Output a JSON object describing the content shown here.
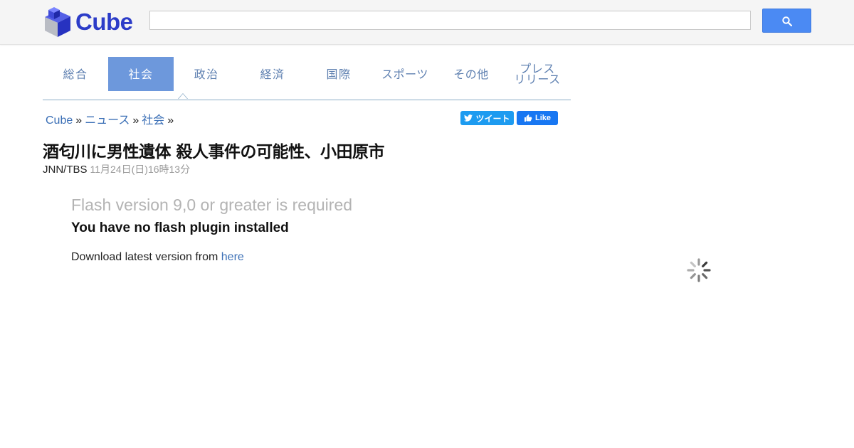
{
  "header": {
    "logo_text": "Cube",
    "search_placeholder": "",
    "search_icon": "search-icon"
  },
  "nav": {
    "tabs": [
      {
        "label": "総合"
      },
      {
        "label": "社会"
      },
      {
        "label": "政治"
      },
      {
        "label": "経済"
      },
      {
        "label": "国際"
      },
      {
        "label": "スポーツ"
      },
      {
        "label": "その他"
      },
      {
        "label_line1": "プレス",
        "label_line2": "リリース"
      }
    ],
    "active_index": 1
  },
  "breadcrumb": {
    "items": [
      "Cube",
      "ニュース",
      "社会"
    ],
    "separator": "»"
  },
  "share": {
    "tweet_label": "ツイート",
    "like_label": "Like"
  },
  "article": {
    "title": "酒匂川に男性遺体 殺人事件の可能性、小田原市",
    "source": "JNN/TBS",
    "date": "11月24日(日)16時13分"
  },
  "flash": {
    "title": "Flash version 9,0 or greater is required",
    "subtitle": "You have no flash plugin installed",
    "download_prefix": "Download latest version from ",
    "download_link": "here"
  },
  "colors": {
    "accent": "#6d98dc",
    "link": "#3b6fb6",
    "brand": "#2c3cc8",
    "search_button": "#4b8af3",
    "tweet": "#1d9bf0",
    "like": "#1877f2"
  },
  "loading": {
    "icon": "loading-spinner-icon"
  }
}
